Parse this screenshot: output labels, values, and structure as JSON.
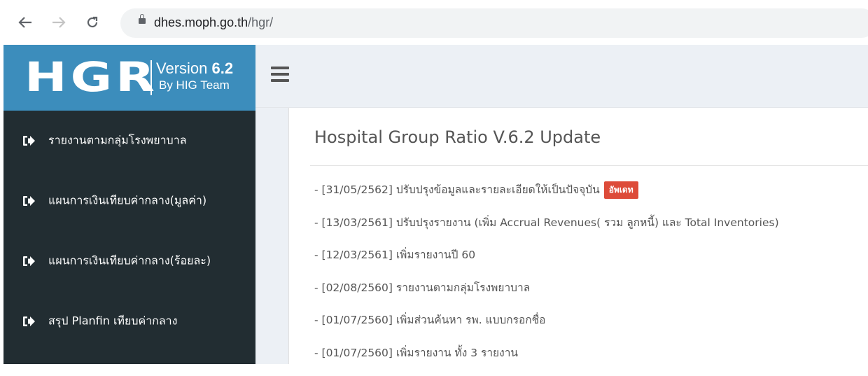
{
  "browser": {
    "url_host": "dhes.moph.go.th",
    "url_path": "/hgr/"
  },
  "logo": {
    "brand": "HGR",
    "version_prefix": "Version ",
    "version_number": "6.2",
    "byline": "By HIG Team"
  },
  "sidebar": {
    "items": [
      {
        "label": "รายงานตามกลุ่มโรงพยาบาล",
        "icon": "sign-in-icon"
      },
      {
        "label": "แผนการเงินเทียบค่ากลาง(มูลค่า)",
        "icon": "sign-in-icon"
      },
      {
        "label": "แผนการเงินเทียบค่ากลาง(ร้อยละ)",
        "icon": "sign-in-icon"
      },
      {
        "label": "สรุป Planfin เทียบค่ากลาง",
        "icon": "sign-in-icon"
      }
    ]
  },
  "main": {
    "title": "Hospital Group Ratio V.6.2 Update",
    "updates": [
      {
        "text": "- [31/05/2562] ปรับปรุงข้อมูลและรายละเอียดให้เป็นปัจจุบัน",
        "badge": "อัพเดท"
      },
      {
        "text": "- [13/03/2561] ปรับปรุงรายงาน (เพิ่ม Accrual Revenues( รวม ลูกหนี้) และ Total Inventories)"
      },
      {
        "text": "- [12/03/2561] เพิ่มรายงานปี 60"
      },
      {
        "text": "- [02/08/2560] รายงานตามกลุ่มโรงพยาบาล"
      },
      {
        "text": "- [01/07/2560] เพิ่มส่วนค้นหา รพ. แบบกรอกชื่อ"
      },
      {
        "text": "- [01/07/2560] เพิ่มรายงาน ทั้ง 3 รายงาน"
      }
    ]
  },
  "colors": {
    "sidebar_bg": "#222d32",
    "logo_bg": "#3c8dbc",
    "content_bg": "#ecf0f5",
    "badge_bg": "#dd4b39"
  }
}
